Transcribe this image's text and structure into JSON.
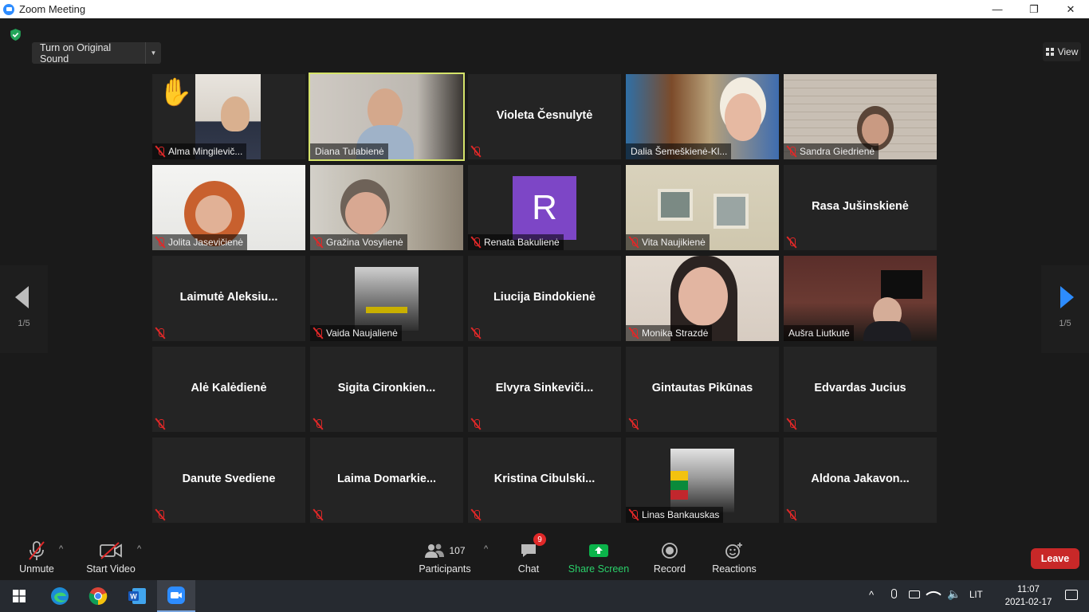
{
  "window": {
    "title": "Zoom Meeting",
    "controls": [
      "—",
      "❐",
      "✕"
    ]
  },
  "top": {
    "original_sound_label": "Turn on Original Sound",
    "view_label": "View",
    "page_left": "1/5",
    "page_right": "1/5"
  },
  "tiles": [
    {
      "name": "Alma Mingilevič...",
      "video": true,
      "raised_hand": true,
      "muted": true
    },
    {
      "name": "Diana Tulabienė",
      "video": true,
      "active_speaker": true,
      "muted": false
    },
    {
      "name": "Violeta Česnulytė",
      "video": false,
      "muted": true
    },
    {
      "name": "Dalia Šemeškienė-Kl...",
      "video": true,
      "muted": false
    },
    {
      "name": "Sandra Giedrienė",
      "video": true,
      "muted": true
    },
    {
      "name": "Jolita Jasevičienė",
      "video": true,
      "muted": true
    },
    {
      "name": "Gražina Vosylienė",
      "video": true,
      "muted": true
    },
    {
      "name": "Renata Bakulienė",
      "video": false,
      "avatar_letter": "R",
      "muted": true
    },
    {
      "name": "Vita Naujikienė",
      "video": true,
      "muted": true
    },
    {
      "name": "Rasa Jušinskienė",
      "video": false,
      "muted": true
    },
    {
      "name": "Laimutė Aleksiu...",
      "video": false,
      "muted": true
    },
    {
      "name": "Vaida Naujalienė",
      "video": false,
      "profile_picture": true,
      "muted": true
    },
    {
      "name": "Liucija Bindokienė",
      "video": false,
      "muted": true
    },
    {
      "name": "Monika Strazdė",
      "video": true,
      "muted": true
    },
    {
      "name": "Aušra Liutkutė",
      "video": true,
      "muted": false
    },
    {
      "name": "Alė Kalėdienė",
      "video": false,
      "muted": true
    },
    {
      "name": "Sigita Cironkien...",
      "video": false,
      "muted": true
    },
    {
      "name": "Elvyra Sinkeviči...",
      "video": false,
      "muted": true
    },
    {
      "name": "Gintautas Pikūnas",
      "video": false,
      "muted": true
    },
    {
      "name": "Edvardas Jucius",
      "video": false,
      "muted": true
    },
    {
      "name": "Danute Svediene",
      "video": false,
      "muted": true
    },
    {
      "name": "Laima Domarkie...",
      "video": false,
      "muted": true
    },
    {
      "name": "Kristina Cibulski...",
      "video": false,
      "muted": true
    },
    {
      "name": "Linas Bankauskas",
      "video": false,
      "profile_picture": true,
      "muted": true
    },
    {
      "name": "Aldona Jakavon...",
      "video": false,
      "muted": true
    }
  ],
  "toolbar": {
    "unmute_label": "Unmute",
    "start_video_label": "Start Video",
    "participants_label": "Participants",
    "participants_count": "107",
    "chat_label": "Chat",
    "chat_badge": "9",
    "share_screen_label": "Share Screen",
    "record_label": "Record",
    "reactions_label": "Reactions",
    "leave_label": "Leave"
  },
  "taskbar": {
    "language": "LIT",
    "time": "11:07",
    "date": "2021-02-17"
  },
  "colors": {
    "accent": "#2d8cff",
    "active_speaker": "#d5e36a",
    "leave": "#c82828",
    "muted": "#e02828",
    "share": "#0bb34a"
  }
}
